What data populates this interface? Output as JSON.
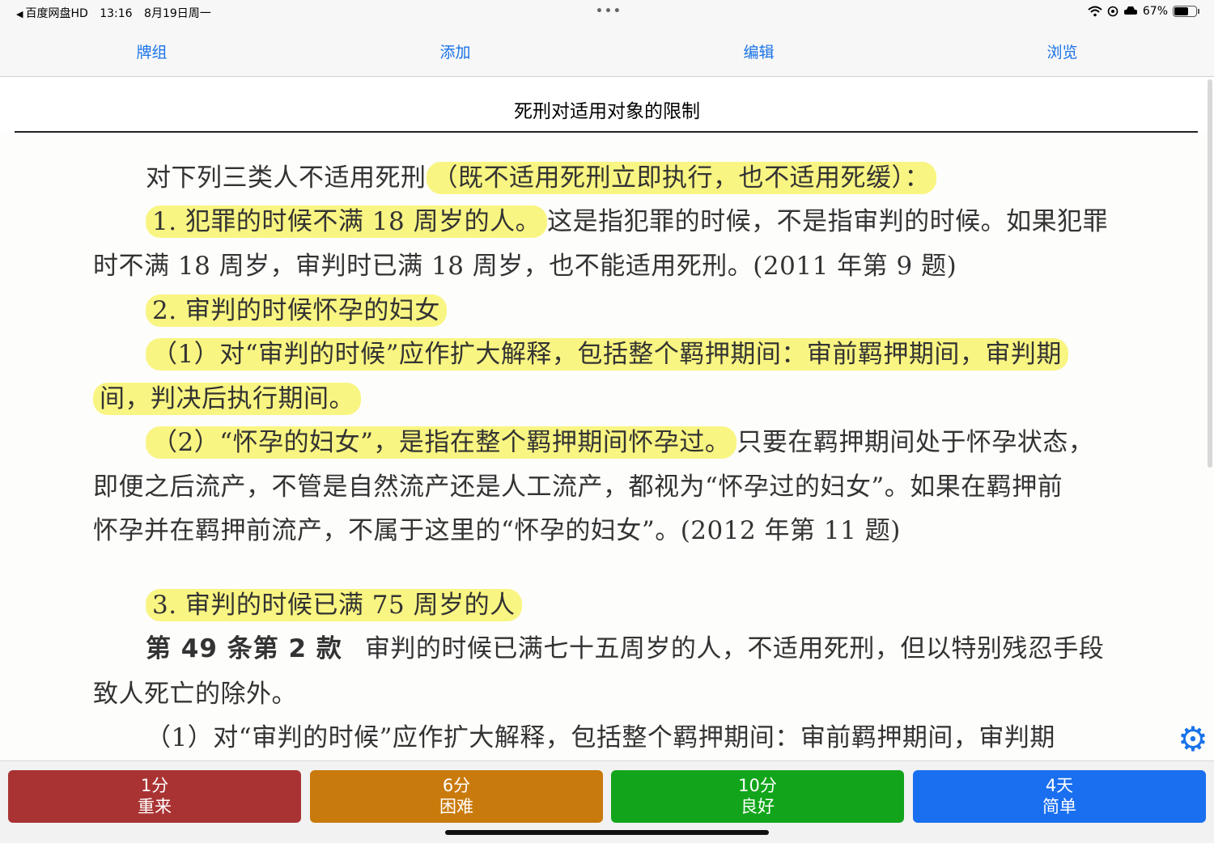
{
  "status_bar": {
    "back_app": "百度网盘HD",
    "time": "13:16",
    "date": "8月19日周一",
    "battery_percent": "67%",
    "battery_level": 0.67
  },
  "toolbar": {
    "decks": "牌组",
    "add": "添加",
    "edit": "编辑",
    "browse": "浏览"
  },
  "card": {
    "title": "死刑对适用对象的限制",
    "lines": [
      {
        "pre": "对下列三类人不适用死刑",
        "hl": "（既不适用死刑立即执行，也不适用死缓）：",
        "post": ""
      },
      {
        "pre": "",
        "hl": "1. 犯罪的时候不满 18 周岁的人。",
        "post": "这是指犯罪的时候，不是指审判的时候。如果犯罪"
      },
      {
        "pre": "时不满 18 周岁，审判时已满 18 周岁，也不能适用死刑。(2011 年第 9 题)",
        "hl": "",
        "post": ""
      },
      {
        "pre": "",
        "hl": "2. 审判的时候怀孕的妇女",
        "post": ""
      },
      {
        "pre": "",
        "hl": "（1）对“审判的时候”应作扩大解释，包括整个羁押期间：审前羁押期间，审判期",
        "post": ""
      },
      {
        "pre": "",
        "hl": "间，判决后执行期间。",
        "post": ""
      },
      {
        "pre": "",
        "hl": "（2）“怀孕的妇女”，是指在整个羁押期间怀孕过。",
        "post": "只要在羁押期间处于怀孕状态，"
      },
      {
        "pre": "即便之后流产，不管是自然流产还是人工流产，都视为“怀孕过的妇女”。如果在羁押前",
        "hl": "",
        "post": ""
      },
      {
        "pre": "怀孕并在羁押前流产，不属于这里的“怀孕的妇女”。(2012 年第 11 题)",
        "hl": "",
        "post": ""
      },
      {
        "pre": "",
        "hl": "3. 审判的时候已满 75 周岁的人",
        "post": ""
      },
      {
        "bold": "第 49 条第 2 款",
        "pre": "审判的时候已满七十五周岁的人，不适用死刑，但以特别残忍手段",
        "hl": "",
        "post": ""
      },
      {
        "pre": "致人死亡的除外。",
        "hl": "",
        "post": ""
      },
      {
        "pre": "（1）对“审判的时候”应作扩大解释，包括整个羁押期间：审前羁押期间，审判期",
        "hl": "",
        "post": ""
      }
    ]
  },
  "answer_buttons": [
    {
      "interval": "1分",
      "label": "重来",
      "color": "#a93333"
    },
    {
      "interval": "6分",
      "label": "困难",
      "color": "#c97a0c"
    },
    {
      "interval": "10分",
      "label": "良好",
      "color": "#12a51b"
    },
    {
      "interval": "4天",
      "label": "简单",
      "color": "#1a6ff0"
    }
  ],
  "icons": {
    "settings": "gear-icon",
    "wifi": "wifi-icon",
    "battery": "battery-icon"
  }
}
